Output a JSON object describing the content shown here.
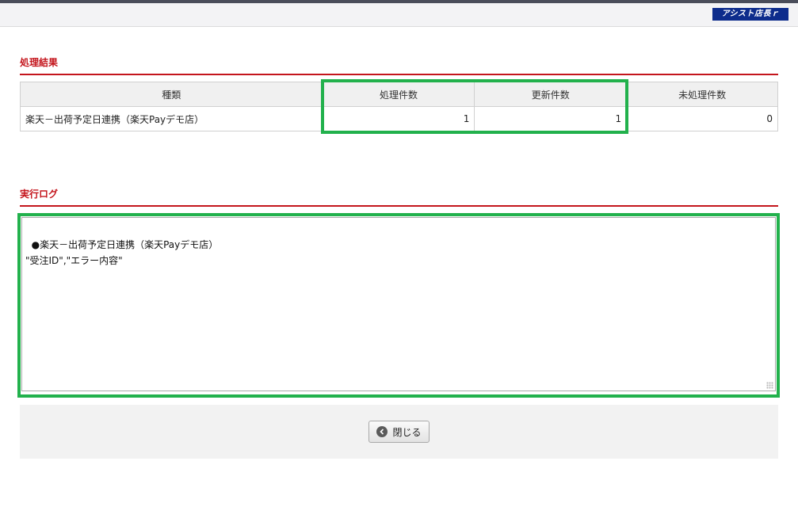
{
  "header": {
    "logo_text": "アシスト店長ｒ"
  },
  "result_section": {
    "title": "処理結果",
    "table": {
      "headers": [
        "種類",
        "処理件数",
        "更新件数",
        "未処理件数"
      ],
      "rows": [
        [
          "楽天－出荷予定日連携（楽天Payデモ店）",
          "1",
          "1",
          "0"
        ]
      ]
    }
  },
  "log_section": {
    "title": "実行ログ",
    "log_text": "●楽天－出荷予定日連携（楽天Payデモ店）\n\"受注ID\",\"エラー内容\""
  },
  "footer": {
    "close_label": "閉じる"
  },
  "colors": {
    "accent_red": "#c4151c",
    "highlight_green": "#22b14c",
    "logo_blue": "#0d2c8c"
  }
}
